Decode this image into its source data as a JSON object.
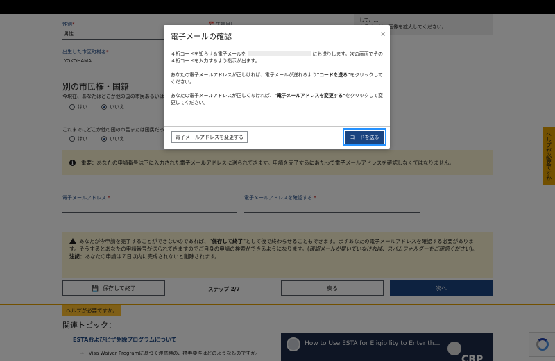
{
  "page": {
    "gender": {
      "label": "性別",
      "required_mark": "*",
      "value": "男性"
    },
    "birthdate": {
      "label": "生年月日"
    },
    "right_panel_text": [
      "して、…",
      "を見るには、画像を拡大してください。"
    ],
    "birthplace": {
      "label": "出生した市区町村名",
      "required_mark": "*",
      "value": "YOKOHAMA"
    },
    "section_title": "別の市民権・国籍",
    "q1": "今現在、あなたはどこか他の国の市民あるいは",
    "q2": "これまでにどこか他の国の市民または国民だっ",
    "yes": "はい",
    "no": "いいえ",
    "info_notice": "重要：あなたの申請番号は下に入力された電子メールアドレスに送られてきます。申請を完了するにあたって電子メールアドレスを確認しなくてはなりません。",
    "email_label": "電子メールアドレス",
    "email_confirm_label": "電子メールアドレスを確認する",
    "warn_line1": "あなたが今申請を完了することができないのであれば、",
    "warn_bold": "\"保存して終了\"",
    "warn_line1b": "として後で終わらせることもできます。まずあなたの電子メールアドレスを確認する必要がありま",
    "warn_line2a": "す。そうするとあなたの申請番号が送られてきますのでご自身の申請の検索ができるようになります。(",
    "warn_italic": "確認メールが届いていなければ、スパムフォルダーをご確認ください",
    "warn_line2b": ")。",
    "warn_note_bold": "注記：",
    "warn_note": "あなたの申請は７日以内に完成されないと削除されます。",
    "save_exit": "保存して終了",
    "step": "ステップ 2/7",
    "back": "戻る",
    "next": "次へ",
    "help_tag": "ヘルプが必要ですか。",
    "related_title": "関連トピック：",
    "related_link": "ESTAおよびビザ免除プログラムについて",
    "related_sub": "→　Visa Waiver Programに基づく渡航時の、携券要件はどのようなものですか。",
    "video_title": "How to Use ESTA for Eligibility to Enter th…",
    "video_brand": "CBP",
    "side_help": "ヘルプが必要ですか"
  },
  "modal": {
    "title": "電子メールの確認",
    "close": "×",
    "p1a": "４桁コードを知らせる電子メールを",
    "p1b": "にお送りします。次の画面でその４桁コードを入力するよう指示が出ます。",
    "p2a": "あなたの電子メールアドレスが正しければ、電子メールが送れるよう",
    "p2_bold": "\"コードを送る\"",
    "p2b": "をクリックしてください。",
    "p3a": "あなたの電子メールアドレスが正しくなければ、",
    "p3_bold": "\"電子メールアドレスを変更する\"",
    "p3b": "をクリックして変更してください。",
    "change_button": "電子メールアドレスを変更する",
    "send_button": "コードを送る"
  },
  "colors": {
    "primary": "#1a4480",
    "focus": "#2491ff",
    "notice_bg": "#faf3d1",
    "help": "#e5a000"
  }
}
